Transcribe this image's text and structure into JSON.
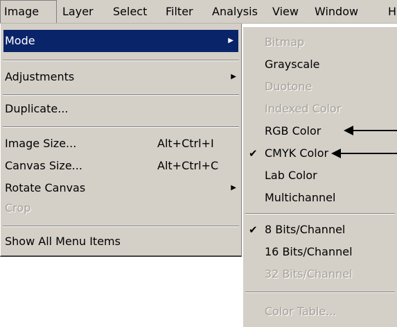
{
  "menubar": {
    "items": [
      "Image",
      "Layer",
      "Select",
      "Filter",
      "Analysis",
      "View",
      "Window",
      "H"
    ]
  },
  "image_menu": {
    "items": [
      {
        "label": "Mode",
        "submenu": true,
        "highlighted": true
      },
      {
        "label": "Adjustments",
        "submenu": true
      },
      {
        "label": "Duplicate..."
      },
      {
        "label": "Image Size...",
        "shortcut": "Alt+Ctrl+I"
      },
      {
        "label": "Canvas Size...",
        "shortcut": "Alt+Ctrl+C"
      },
      {
        "label": "Rotate Canvas",
        "submenu": true
      },
      {
        "label": "Crop",
        "disabled": true
      },
      {
        "label": "Show All Menu Items"
      }
    ]
  },
  "mode_submenu": {
    "items": [
      {
        "label": "Bitmap",
        "disabled": true
      },
      {
        "label": "Grayscale"
      },
      {
        "label": "Duotone",
        "disabled": true
      },
      {
        "label": "Indexed Color",
        "disabled": true
      },
      {
        "label": "RGB Color"
      },
      {
        "label": "CMYK Color",
        "checked": true
      },
      {
        "label": "Lab Color"
      },
      {
        "label": "Multichannel"
      },
      {
        "label": "8 Bits/Channel",
        "checked": true
      },
      {
        "label": "16 Bits/Channel"
      },
      {
        "label": "32 Bits/Channel",
        "disabled": true
      },
      {
        "label": "Color Table...",
        "disabled": true
      }
    ]
  },
  "glyphs": {
    "submenu_arrow": "▶",
    "checkmark": "✔"
  }
}
